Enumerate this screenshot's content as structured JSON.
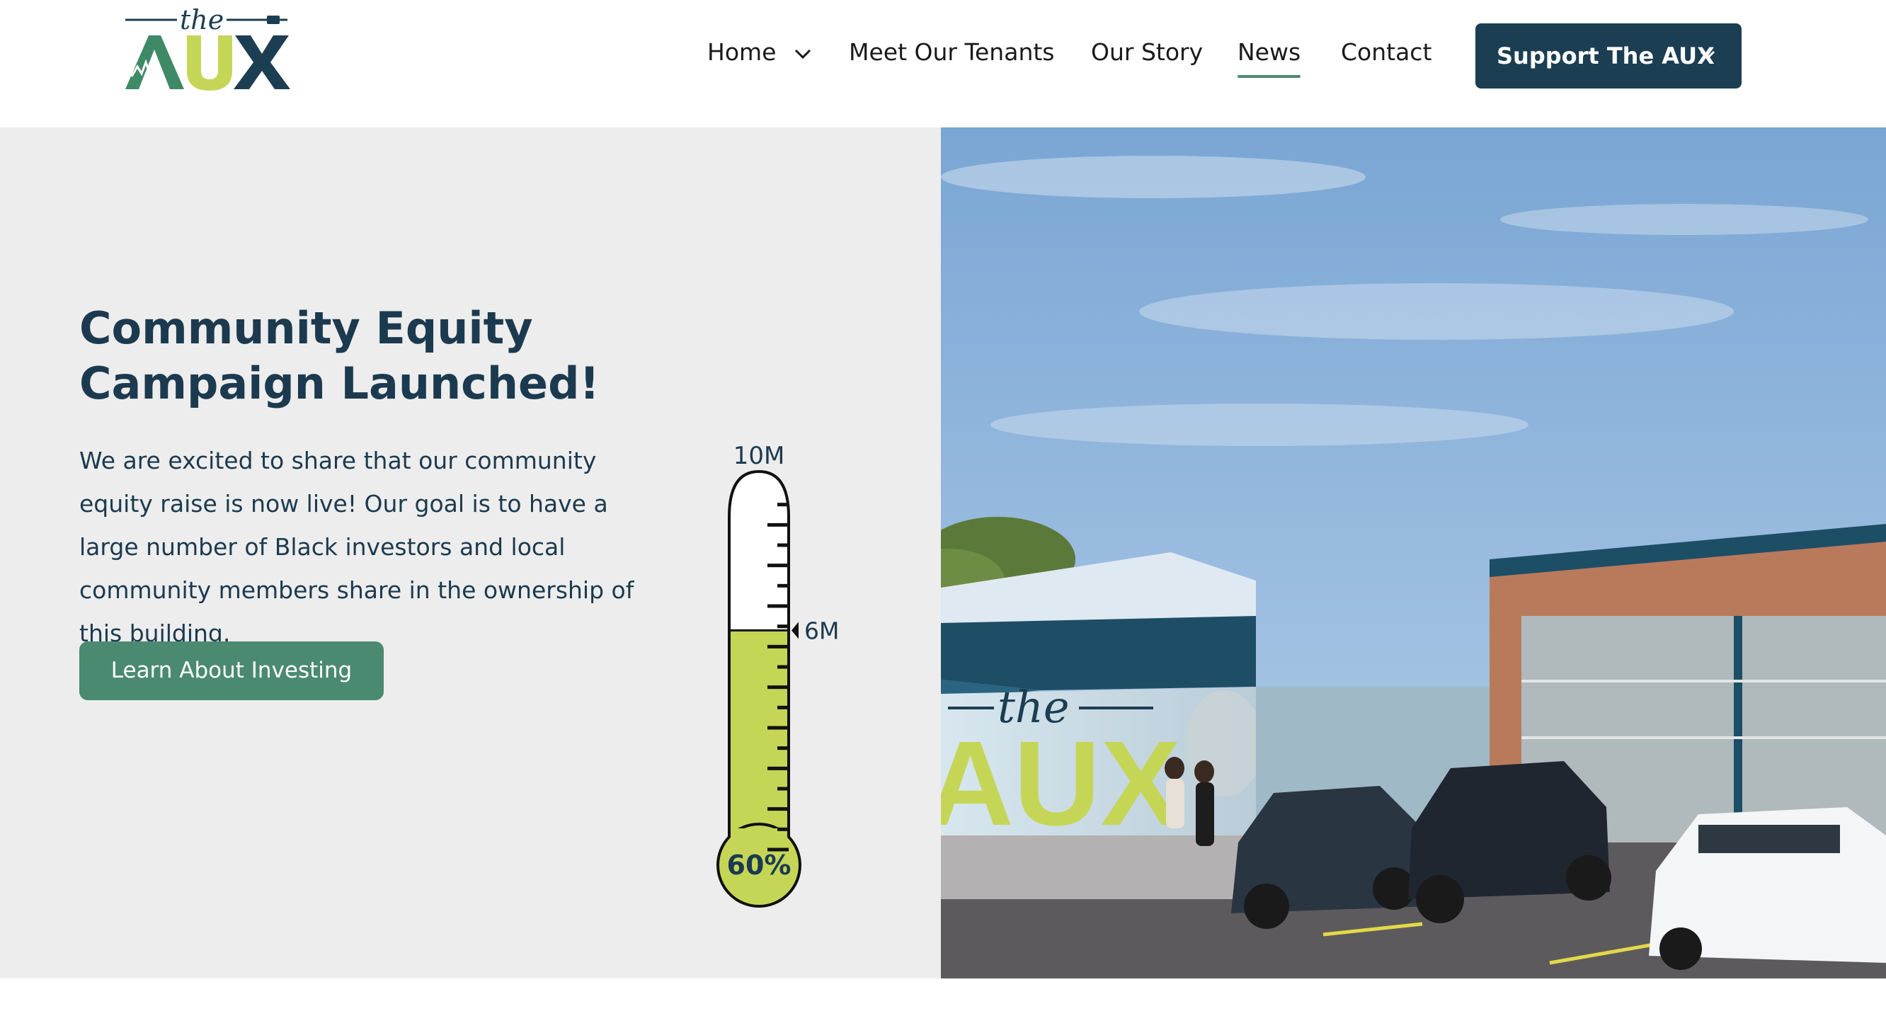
{
  "brand": {
    "logo_the": "the",
    "logo_aux": "AUX",
    "colors": {
      "navy": "#1c3e52",
      "green": "#4a8a70",
      "lime": "#c5d657",
      "light_gray": "#ededed"
    }
  },
  "nav": {
    "items": [
      {
        "label": "Home",
        "has_dropdown": true
      },
      {
        "label": "Meet Our Tenants",
        "has_dropdown": false
      },
      {
        "label": "Our Story",
        "has_dropdown": false
      },
      {
        "label": "News",
        "has_dropdown": false,
        "active": true
      },
      {
        "label": "Contact",
        "has_dropdown": false
      }
    ],
    "cta": {
      "label": "Support The AUX",
      "has_dropdown": true
    }
  },
  "hero": {
    "title_line1": "Community Equity",
    "title_line2": "Campaign Launched!",
    "body": "We are excited to share that our community equity raise is now live! Our goal is to have a large number of Black investors and local community members share in the ownership of this building.",
    "button_label": "Learn About Investing",
    "thermometer": {
      "top_label": "10M",
      "marker_label": "6M",
      "percent_label": "60%",
      "goal": 10,
      "raised": 6,
      "fill_fraction": 0.6,
      "fill_color": "#c5d657"
    },
    "image": {
      "mural_the": "the",
      "mural_aux": "AUX",
      "icons": [
        "building-rendering",
        "car-icon"
      ]
    }
  }
}
